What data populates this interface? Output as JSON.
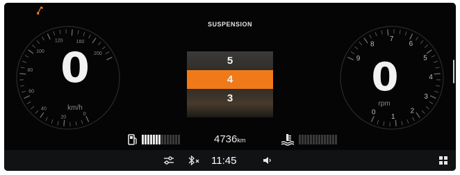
{
  "speedometer": {
    "value": "0",
    "unit": "km/h",
    "ticks": [
      "0",
      "20",
      "40",
      "60",
      "80",
      "100",
      "120",
      "160",
      "200"
    ]
  },
  "tachometer": {
    "value": "0",
    "unit": "rpm",
    "ticks": [
      "0",
      "1",
      "2",
      "3",
      "4",
      "5",
      "6",
      "7",
      "8",
      "9"
    ]
  },
  "suspension": {
    "title": "SUSPENSION",
    "levels": [
      "5",
      "4",
      "3"
    ],
    "selected": "4"
  },
  "odometer": {
    "value": "4736",
    "unit": "km"
  },
  "fuel": {
    "segments_total": 14,
    "segments_filled": 7
  },
  "coolant": {
    "segments_total": 14,
    "segments_filled": 0
  },
  "status_bar": {
    "time": "11:45"
  },
  "icons": {
    "warning": "wrench-warning-icon",
    "fuel": "fuel-pump-icon",
    "coolant": "coolant-temperature-icon",
    "settings": "sliders-icon",
    "bluetooth": "bluetooth-off-icon",
    "volume": "speaker-icon",
    "apps": "grid-icon"
  },
  "colors": {
    "accent": "#f07a1a",
    "background": "#050505"
  }
}
